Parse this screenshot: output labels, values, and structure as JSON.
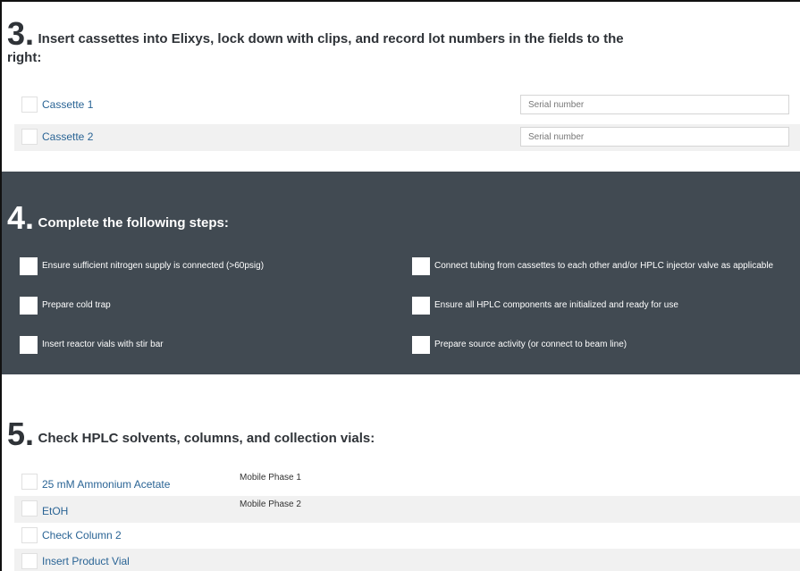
{
  "section3": {
    "number": "3.",
    "title": "Insert cassettes into Elixys, lock down with clips, and record lot numbers in the fields to the right:",
    "rows": [
      {
        "label": "Cassette 1",
        "placeholder": "Serial number"
      },
      {
        "label": "Cassette 2",
        "placeholder": "Serial number"
      }
    ]
  },
  "section4": {
    "number": "4.",
    "title": "Complete the following steps:",
    "left_steps": [
      "Ensure sufficient nitrogen supply is connected (>60psig)",
      "Prepare cold trap",
      "Insert reactor vials with stir bar"
    ],
    "right_steps": [
      "Connect tubing from cassettes to each other and/or HPLC injector valve as applicable",
      "Ensure all HPLC components are initialized and ready for use",
      "Prepare source activity (or connect to beam line)"
    ]
  },
  "section5": {
    "number": "5.",
    "title": "Check HPLC solvents, columns, and collection vials:",
    "rows": [
      {
        "label": "25 mM Ammonium Acetate",
        "note": "Mobile Phase 1"
      },
      {
        "label": "EtOH",
        "note": "Mobile Phase 2"
      },
      {
        "label": "Check Column 2",
        "note": ""
      },
      {
        "label": "Insert Product Vial",
        "note": ""
      }
    ]
  },
  "colors": {
    "dark_panel": "#414a52",
    "link": "#2a6495",
    "row_alt": "#f1f1f1"
  }
}
